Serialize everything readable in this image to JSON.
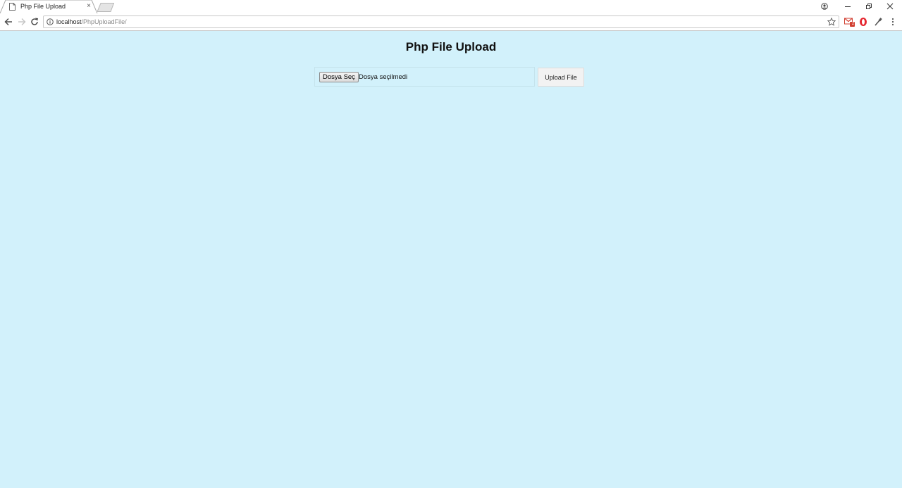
{
  "browser": {
    "tab": {
      "title": "Php File Upload",
      "close_glyph": "×"
    },
    "address": {
      "host": "localhost",
      "path": "/PhpUploadFile/"
    },
    "icons": {
      "favicon": "page-icon",
      "back": "arrow-left-icon",
      "forward": "arrow-right-icon",
      "reload": "reload-icon",
      "info": "info-icon",
      "bookmark": "star-icon",
      "profile": "profile-icon",
      "minimize": "minimize-icon",
      "restore": "restore-icon",
      "close": "close-icon",
      "mail_ext": "gmail-extension-icon",
      "opera_ext": "opera-extension-icon",
      "eyedropper_ext": "eyedropper-icon",
      "menu": "kebab-menu-icon"
    },
    "mail_badge": "2"
  },
  "page": {
    "title": "Php File Upload",
    "file_input": {
      "button_label": "Dosya Seç",
      "status": "Dosya seçilmedi"
    },
    "upload_button_label": "Upload File",
    "background_color": "#d2f1fb"
  }
}
